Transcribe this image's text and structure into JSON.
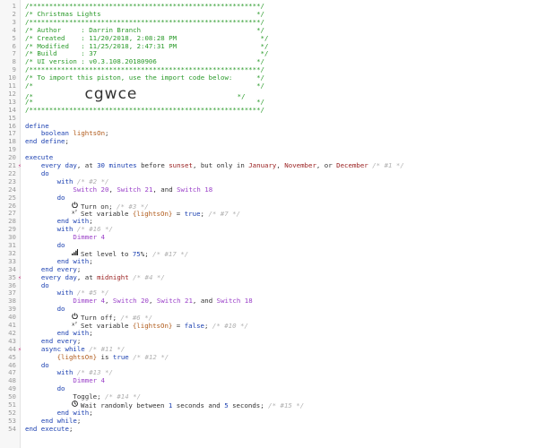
{
  "lines": [
    {
      "n": "1",
      "tokens": [
        {
          "c": "cm",
          "t": "/**********************************************************/"
        }
      ]
    },
    {
      "n": "2",
      "tokens": [
        {
          "c": "cm",
          "t": "/* Christmas Lights                                       */"
        }
      ]
    },
    {
      "n": "3",
      "tokens": [
        {
          "c": "cm",
          "t": "/**********************************************************/"
        }
      ]
    },
    {
      "n": "4",
      "tokens": [
        {
          "c": "cm",
          "t": "/* Author     : Darrin Branch                             */"
        }
      ]
    },
    {
      "n": "5",
      "tokens": [
        {
          "c": "cm",
          "t": "/* Created    : 11/20/2018, 2:08:28 PM                     */"
        }
      ]
    },
    {
      "n": "6",
      "tokens": [
        {
          "c": "cm",
          "t": "/* Modified   : 11/25/2018, 2:47:31 PM                     */"
        }
      ]
    },
    {
      "n": "7",
      "tokens": [
        {
          "c": "cm",
          "t": "/* Build      : 37                                         */"
        }
      ]
    },
    {
      "n": "8",
      "tokens": [
        {
          "c": "cm",
          "t": "/* UI version : v0.3.108.20180906                         */"
        }
      ]
    },
    {
      "n": "9",
      "tokens": [
        {
          "c": "cm",
          "t": "/**********************************************************/"
        }
      ]
    },
    {
      "n": "10",
      "tokens": [
        {
          "c": "cm",
          "t": "/* To import this piston, use the import code below:      */"
        }
      ]
    },
    {
      "n": "11",
      "tokens": [
        {
          "c": "cm",
          "t": "/*                                                        */"
        }
      ]
    },
    {
      "n": "12",
      "tokens": [
        {
          "c": "cm",
          "t": "/*"
        },
        {
          "c": "id",
          "t": "         cgwce"
        },
        {
          "c": "cm",
          "t": "                         */"
        }
      ]
    },
    {
      "n": "13",
      "tokens": [
        {
          "c": "cm",
          "t": "/*                                                        */"
        }
      ]
    },
    {
      "n": "14",
      "tokens": [
        {
          "c": "cm",
          "t": "/**********************************************************/"
        }
      ]
    },
    {
      "n": "15",
      "tokens": []
    },
    {
      "n": "16",
      "tokens": [
        {
          "c": "kw",
          "t": "define"
        }
      ]
    },
    {
      "n": "17",
      "tokens": [
        {
          "c": "txt",
          "t": "    "
        },
        {
          "c": "kw",
          "t": "boolean"
        },
        {
          "c": "txt",
          "t": " "
        },
        {
          "c": "var",
          "t": "lightsOn"
        },
        {
          "c": "txt",
          "t": ";"
        }
      ]
    },
    {
      "n": "18",
      "tokens": [
        {
          "c": "kw",
          "t": "end define"
        },
        {
          "c": "txt",
          "t": ";"
        }
      ]
    },
    {
      "n": "19",
      "tokens": []
    },
    {
      "n": "20",
      "tokens": [
        {
          "c": "kw",
          "t": "execute"
        }
      ]
    },
    {
      "n": "21",
      "mark": "⚡",
      "tokens": [
        {
          "c": "txt",
          "t": "    "
        },
        {
          "c": "kw",
          "t": "every day"
        },
        {
          "c": "txt",
          "t": ", at "
        },
        {
          "c": "num",
          "t": "30"
        },
        {
          "c": "txt",
          "t": " "
        },
        {
          "c": "kw",
          "t": "minutes"
        },
        {
          "c": "txt",
          "t": " before "
        },
        {
          "c": "str",
          "t": "sunset"
        },
        {
          "c": "txt",
          "t": ", but only in "
        },
        {
          "c": "str",
          "t": "January"
        },
        {
          "c": "txt",
          "t": ", "
        },
        {
          "c": "str",
          "t": "November"
        },
        {
          "c": "txt",
          "t": ", or "
        },
        {
          "c": "str",
          "t": "December"
        },
        {
          "c": "txt",
          "t": " "
        },
        {
          "c": "cmi",
          "t": "/* #1 */"
        }
      ]
    },
    {
      "n": "22",
      "tokens": [
        {
          "c": "txt",
          "t": "    "
        },
        {
          "c": "kw",
          "t": "do"
        }
      ]
    },
    {
      "n": "23",
      "tokens": [
        {
          "c": "txt",
          "t": "        "
        },
        {
          "c": "kw",
          "t": "with"
        },
        {
          "c": "txt",
          "t": " "
        },
        {
          "c": "cmi",
          "t": "/* #2 */"
        }
      ]
    },
    {
      "n": "24",
      "tokens": [
        {
          "c": "txt",
          "t": "            "
        },
        {
          "c": "dev",
          "t": "Switch 20"
        },
        {
          "c": "txt",
          "t": ", "
        },
        {
          "c": "dev",
          "t": "Switch 21"
        },
        {
          "c": "txt",
          "t": ", and "
        },
        {
          "c": "dev",
          "t": "Switch 18"
        }
      ]
    },
    {
      "n": "25",
      "tokens": [
        {
          "c": "txt",
          "t": "        "
        },
        {
          "c": "kw",
          "t": "do"
        }
      ]
    },
    {
      "n": "26",
      "icon": "power-icon",
      "tokens": [
        {
          "c": "txt",
          "t": "Turn on; "
        },
        {
          "c": "cmi",
          "t": "/* #3 */"
        }
      ]
    },
    {
      "n": "27",
      "icon": "variable-icon",
      "tokens": [
        {
          "c": "txt",
          "t": "Set variable "
        },
        {
          "c": "var",
          "t": "{lightsOn}"
        },
        {
          "c": "txt",
          "t": " = "
        },
        {
          "c": "kw",
          "t": "true"
        },
        {
          "c": "txt",
          "t": "; "
        },
        {
          "c": "cmi",
          "t": "/* #7 */"
        }
      ]
    },
    {
      "n": "28",
      "tokens": [
        {
          "c": "txt",
          "t": "        "
        },
        {
          "c": "kw",
          "t": "end with"
        },
        {
          "c": "txt",
          "t": ";"
        }
      ]
    },
    {
      "n": "29",
      "tokens": [
        {
          "c": "txt",
          "t": "        "
        },
        {
          "c": "kw",
          "t": "with"
        },
        {
          "c": "txt",
          "t": " "
        },
        {
          "c": "cmi",
          "t": "/* #16 */"
        }
      ]
    },
    {
      "n": "30",
      "tokens": [
        {
          "c": "txt",
          "t": "            "
        },
        {
          "c": "dev",
          "t": "Dimmer 4"
        }
      ]
    },
    {
      "n": "31",
      "tokens": [
        {
          "c": "txt",
          "t": "        "
        },
        {
          "c": "kw",
          "t": "do"
        }
      ]
    },
    {
      "n": "32",
      "icon": "level-icon",
      "tokens": [
        {
          "c": "txt",
          "t": "Set level to "
        },
        {
          "c": "num",
          "t": "75"
        },
        {
          "c": "txt",
          "t": "%; "
        },
        {
          "c": "cmi",
          "t": "/* #17 */"
        }
      ]
    },
    {
      "n": "33",
      "tokens": [
        {
          "c": "txt",
          "t": "        "
        },
        {
          "c": "kw",
          "t": "end with"
        },
        {
          "c": "txt",
          "t": ";"
        }
      ]
    },
    {
      "n": "34",
      "tokens": [
        {
          "c": "txt",
          "t": "    "
        },
        {
          "c": "kw",
          "t": "end every"
        },
        {
          "c": "txt",
          "t": ";"
        }
      ]
    },
    {
      "n": "35",
      "mark": "⚡",
      "tokens": [
        {
          "c": "txt",
          "t": "    "
        },
        {
          "c": "kw",
          "t": "every day"
        },
        {
          "c": "txt",
          "t": ", at "
        },
        {
          "c": "str",
          "t": "midnight"
        },
        {
          "c": "txt",
          "t": " "
        },
        {
          "c": "cmi",
          "t": "/* #4 */"
        }
      ]
    },
    {
      "n": "36",
      "tokens": [
        {
          "c": "txt",
          "t": "    "
        },
        {
          "c": "kw",
          "t": "do"
        }
      ]
    },
    {
      "n": "37",
      "tokens": [
        {
          "c": "txt",
          "t": "        "
        },
        {
          "c": "kw",
          "t": "with"
        },
        {
          "c": "txt",
          "t": " "
        },
        {
          "c": "cmi",
          "t": "/* #5 */"
        }
      ]
    },
    {
      "n": "38",
      "tokens": [
        {
          "c": "txt",
          "t": "            "
        },
        {
          "c": "dev",
          "t": "Dimmer 4"
        },
        {
          "c": "txt",
          "t": ", "
        },
        {
          "c": "dev",
          "t": "Switch 20"
        },
        {
          "c": "txt",
          "t": ", "
        },
        {
          "c": "dev",
          "t": "Switch 21"
        },
        {
          "c": "txt",
          "t": ", and "
        },
        {
          "c": "dev",
          "t": "Switch 18"
        }
      ]
    },
    {
      "n": "39",
      "tokens": [
        {
          "c": "txt",
          "t": "        "
        },
        {
          "c": "kw",
          "t": "do"
        }
      ]
    },
    {
      "n": "40",
      "icon": "power-icon",
      "tokens": [
        {
          "c": "txt",
          "t": "Turn off; "
        },
        {
          "c": "cmi",
          "t": "/* #6 */"
        }
      ]
    },
    {
      "n": "41",
      "icon": "variable-icon",
      "tokens": [
        {
          "c": "txt",
          "t": "Set variable "
        },
        {
          "c": "var",
          "t": "{lightsOn}"
        },
        {
          "c": "txt",
          "t": " = "
        },
        {
          "c": "kw",
          "t": "false"
        },
        {
          "c": "txt",
          "t": "; "
        },
        {
          "c": "cmi",
          "t": "/* #10 */"
        }
      ]
    },
    {
      "n": "42",
      "tokens": [
        {
          "c": "txt",
          "t": "        "
        },
        {
          "c": "kw",
          "t": "end with"
        },
        {
          "c": "txt",
          "t": ";"
        }
      ]
    },
    {
      "n": "43",
      "tokens": [
        {
          "c": "txt",
          "t": "    "
        },
        {
          "c": "kw",
          "t": "end every"
        },
        {
          "c": "txt",
          "t": ";"
        }
      ]
    },
    {
      "n": "44",
      "mark": "⚡",
      "tokens": [
        {
          "c": "txt",
          "t": "    "
        },
        {
          "c": "kw",
          "t": "async while"
        },
        {
          "c": "txt",
          "t": " "
        },
        {
          "c": "cmi",
          "t": "/* #11 */"
        }
      ]
    },
    {
      "n": "45",
      "tokens": [
        {
          "c": "txt",
          "t": "        "
        },
        {
          "c": "var",
          "t": "{lightsOn}"
        },
        {
          "c": "txt",
          "t": " is "
        },
        {
          "c": "kw",
          "t": "true"
        },
        {
          "c": "txt",
          "t": " "
        },
        {
          "c": "cmi",
          "t": "/* #12 */"
        }
      ]
    },
    {
      "n": "46",
      "tokens": [
        {
          "c": "txt",
          "t": "    "
        },
        {
          "c": "kw",
          "t": "do"
        }
      ]
    },
    {
      "n": "47",
      "tokens": [
        {
          "c": "txt",
          "t": "        "
        },
        {
          "c": "kw",
          "t": "with"
        },
        {
          "c": "txt",
          "t": " "
        },
        {
          "c": "cmi",
          "t": "/* #13 */"
        }
      ]
    },
    {
      "n": "48",
      "tokens": [
        {
          "c": "txt",
          "t": "            "
        },
        {
          "c": "dev",
          "t": "Dimmer 4"
        }
      ]
    },
    {
      "n": "49",
      "tokens": [
        {
          "c": "txt",
          "t": "        "
        },
        {
          "c": "kw",
          "t": "do"
        }
      ]
    },
    {
      "n": "50",
      "tokens": [
        {
          "c": "txt",
          "t": "            Toggle; "
        },
        {
          "c": "cmi",
          "t": "/* #14 */"
        }
      ]
    },
    {
      "n": "51",
      "icon": "clock-icon",
      "tokens": [
        {
          "c": "txt",
          "t": "Wait randomly between "
        },
        {
          "c": "num",
          "t": "1"
        },
        {
          "c": "txt",
          "t": " seconds and "
        },
        {
          "c": "num",
          "t": "5"
        },
        {
          "c": "txt",
          "t": " seconds; "
        },
        {
          "c": "cmi",
          "t": "/* #15 */"
        }
      ]
    },
    {
      "n": "52",
      "tokens": [
        {
          "c": "txt",
          "t": "        "
        },
        {
          "c": "kw",
          "t": "end with"
        },
        {
          "c": "txt",
          "t": ";"
        }
      ]
    },
    {
      "n": "53",
      "tokens": [
        {
          "c": "txt",
          "t": "    "
        },
        {
          "c": "kw",
          "t": "end while"
        },
        {
          "c": "txt",
          "t": ";"
        }
      ]
    },
    {
      "n": "54",
      "tokens": [
        {
          "c": "kw",
          "t": "end execute"
        },
        {
          "c": "txt",
          "t": ";"
        }
      ]
    }
  ],
  "colors": {
    "comment": "#2a9a2a",
    "keyword": "#1a3fb0",
    "device": "#9a40c8",
    "variable": "#b05a1a",
    "string": "#9a2020",
    "marker": "#cc2277"
  }
}
